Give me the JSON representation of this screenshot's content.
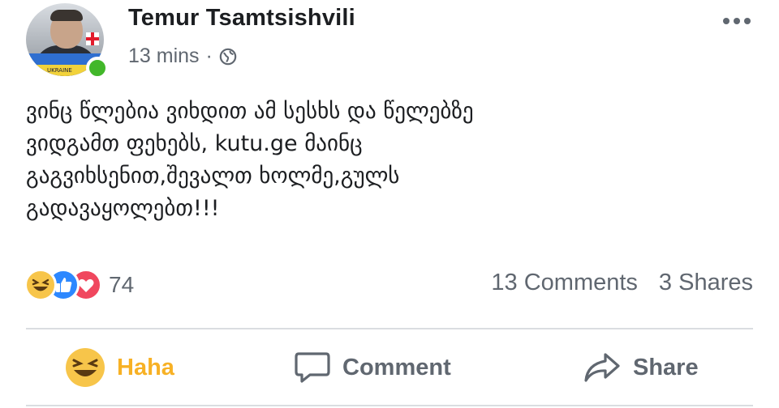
{
  "post": {
    "author": "Temur Tsamtsishvili",
    "time": "13 mins",
    "separator": "·",
    "privacy_icon": "globe-icon",
    "menu_icon": "more-options-icon",
    "avatar_caption": "UKRAINE",
    "text": "ვინც წლებია ვიხდით ამ სესხს და წელებზე\nვიდგამთ ფეხებს, kutu.ge მაინც\nგაგვიხსენით,შევალთ ხოლმე,გულს\nგადავაყოლებთ!!!"
  },
  "reactions": {
    "icons": [
      "haha-reaction-icon",
      "like-reaction-icon",
      "love-reaction-icon"
    ],
    "count": "74",
    "comments": "13 Comments",
    "shares": "3 Shares"
  },
  "actions": {
    "haha_label": "Haha",
    "comment_label": "Comment",
    "share_label": "Share"
  },
  "colors": {
    "haha_yellow": "#f7b125",
    "like_blue": "#2d88ff",
    "love_red": "#f0475e",
    "online_green": "#42b72a",
    "secondary_text": "#606770"
  }
}
